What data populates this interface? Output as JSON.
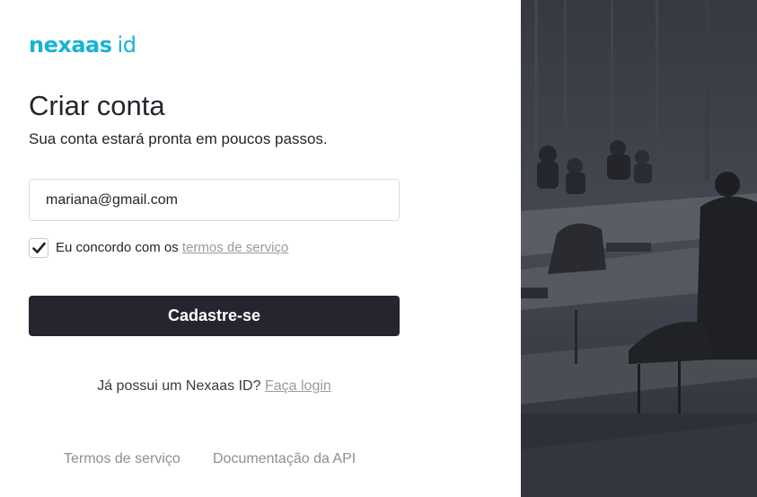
{
  "logo": {
    "brand": "nexaas",
    "suffix": "id"
  },
  "form": {
    "title": "Criar conta",
    "subtitle": "Sua conta estará pronta em poucos passos.",
    "email_value": "mariana@gmail.com",
    "agree_checked": true,
    "agree_prefix": "Eu concordo com os",
    "agree_link": "termos de serviço",
    "submit_label": "Cadastre-se"
  },
  "login": {
    "prompt": "Já possui um Nexaas ID?",
    "link": "Faça login"
  },
  "footer": {
    "terms": "Termos de serviço",
    "api_docs": "Documentação da API"
  },
  "colors": {
    "brand": "#15b4d6",
    "button": "#25252f",
    "panel": "#3d4048"
  },
  "photo": {
    "description_icon": "classroom-photo"
  }
}
